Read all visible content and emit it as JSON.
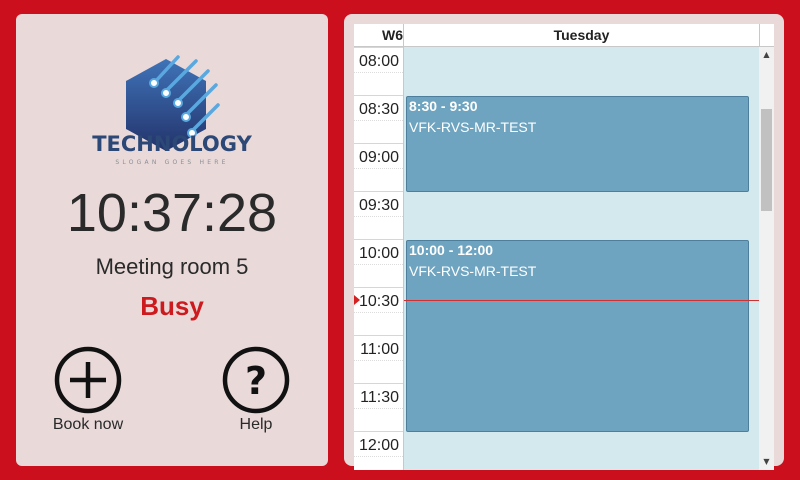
{
  "branding": {
    "logo_word": "TECHNOLOGY",
    "logo_slogan": "SLOGAN GOES HERE",
    "logo_color": "#2c4876",
    "accent": "#cc0f1c"
  },
  "clock": "10:37:28",
  "room": {
    "name": "Meeting room 5",
    "status": "Busy",
    "status_color": "#cc1a1e"
  },
  "actions": [
    {
      "label": "Book now",
      "icon": "plus-circle-icon"
    },
    {
      "label": "Help",
      "icon": "question-circle-icon"
    }
  ],
  "calendar": {
    "week": "W6",
    "day": "Tuesday",
    "times": [
      "08:00",
      "08:30",
      "09:00",
      "09:30",
      "10:00",
      "10:30",
      "11:00",
      "11:30",
      "12:00"
    ],
    "events": [
      {
        "time": "8:30 - 9:30",
        "title": "VFK-RVS-MR-TEST"
      },
      {
        "time": "10:00 - 12:00",
        "title": "VFK-RVS-MR-TEST"
      }
    ],
    "current_time": "10:30",
    "event_color": "#6ea4c0",
    "background_color": "#d3e9ee"
  }
}
